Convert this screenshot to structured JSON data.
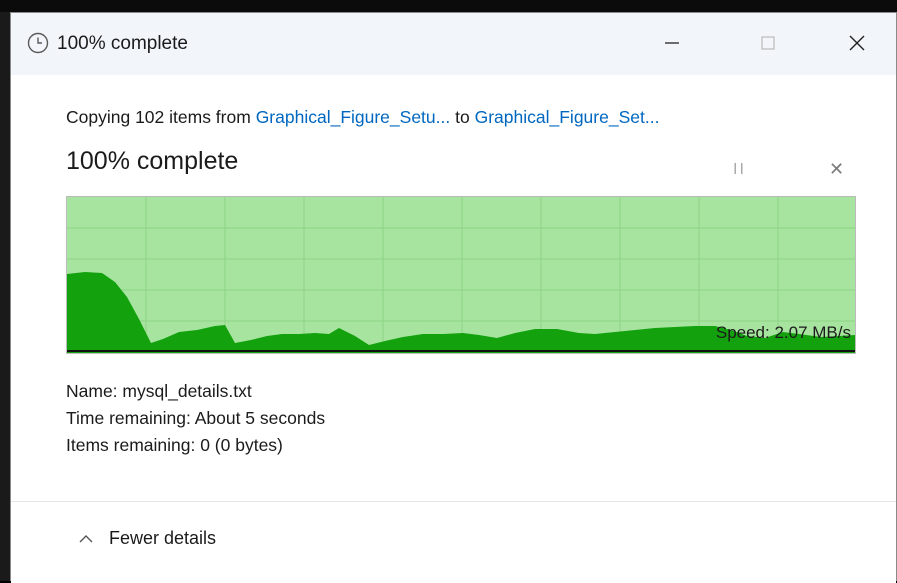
{
  "window": {
    "title": "100% complete",
    "icons": {
      "title": "clock-icon",
      "minimize": "minimize-icon",
      "maximize": "maximize-icon",
      "close": "close-icon"
    }
  },
  "copy": {
    "prefix": "Copying 102 items from",
    "source": "Graphical_Figure_Setu...",
    "middle": "to",
    "destination": "Graphical_Figure_Set..."
  },
  "progress": {
    "label": "100% complete",
    "value_percent": 100,
    "pause_icon": "pause-icon",
    "cancel_icon": "cancel-icon"
  },
  "speed_graph": {
    "speed_label": "Speed: 2.07 MB/s",
    "color_fill": "#13a10e",
    "color_background": "#a7e4a0",
    "color_grid": "#8fd386"
  },
  "details": {
    "name": "Name:  mysql_details.txt",
    "time_remaining": "Time remaining:  About 5 seconds",
    "items_remaining": "Items remaining:  0 (0 bytes)"
  },
  "footer": {
    "toggle_label": "Fewer details",
    "toggle_icon": "chevron-up-icon"
  }
}
